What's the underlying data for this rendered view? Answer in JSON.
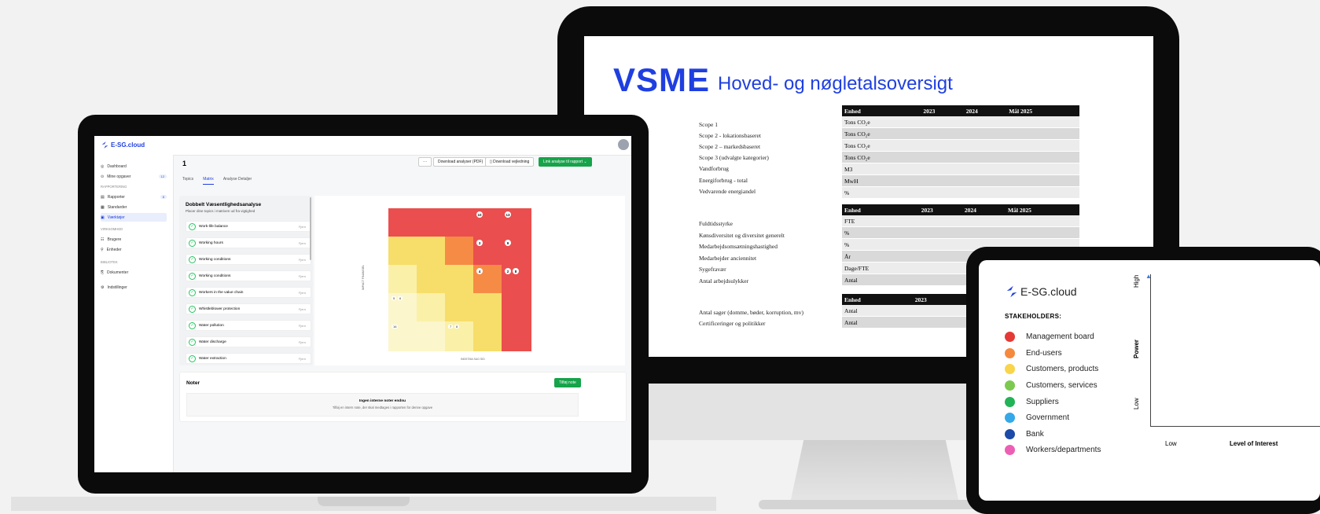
{
  "monitor": {
    "title_big": "VSME",
    "title_sub": "Hoved- og nøgletalsoversigt",
    "table_headers": [
      "Enhed",
      "2023",
      "2024",
      "Mål 2025"
    ],
    "table1": {
      "labels": [
        "Scope 1",
        "Scope 2 - lokationsbaseret",
        "Scope 2 – markedsbaseret",
        "Scope 3 (udvalgte kategorier)",
        "Vandforbrug",
        "Energiforbrug - total",
        "Vedvarende energiandel"
      ],
      "units": [
        "Tons CO₂e",
        "Tons CO₂e",
        "Tons CO₂e",
        "Tons CO₂e",
        "M3",
        "MwH",
        "%"
      ]
    },
    "table2": {
      "labels": [
        "Fuldtidsstyrke",
        "Kønsdiversitet og diversitet generelt",
        "Medarbejdsomsætningshastighed",
        "Medarbejder anciennitet",
        "Sygefravær",
        "Antal arbejdsulykker"
      ],
      "units": [
        "FTE",
        "%",
        "%",
        "År",
        "Dage/FTE",
        "Antal"
      ]
    },
    "table3": {
      "labels": [
        "Antal sager (domme, bøder, korruption, mv)",
        "Certificeringer og politikker"
      ],
      "units": [
        "Antal",
        "Antal"
      ]
    }
  },
  "laptop": {
    "brand": "E-SG.cloud",
    "sidebar": {
      "dashboard": "Dashboard",
      "tasks": "Mine opgaver",
      "tasks_badge": "12",
      "section_reporting": "RAPPORTERING",
      "reports": "Rapporter",
      "reports_badge": "8",
      "standards": "Standarder",
      "templates": "Værktøjer",
      "section_company": "VIRKSOMHED",
      "users": "Brugere",
      "entities": "Enheder",
      "section_library": "BIBLIOTEK",
      "documents": "Dokumenter",
      "settings": "Indstillinger"
    },
    "page_number": "1",
    "buttons": {
      "more": "···",
      "download_pdf": "Download analyser (PDF)",
      "download_guide": "Download vejledning",
      "link_report": "Link analyse til rapport"
    },
    "tabs": [
      "Topics",
      "Matrix",
      "Analyse Detaljer"
    ],
    "panel_title": "Dobbelt Væsentlighedsanalyse",
    "panel_subtitle": "Placer dine topics i matrixen ud fra vigtighed",
    "remove_label": "Fjern",
    "topics": [
      "Work-life balance",
      "Working hours",
      "Working conditions",
      "Working conditions",
      "Workers in the value chain",
      "Whistleblower protection",
      "Water pollution",
      "Water discharge",
      "Water extraction"
    ],
    "matrix_y_label": "IMPACT FINANSIEL",
    "matrix_x_label": "INDSTMA SAG SID",
    "matrix_dots": [
      "10",
      "13",
      "3",
      "9",
      "4",
      "2",
      "8"
    ],
    "matrix_chips": [
      "5",
      "6",
      "16",
      "7",
      "8"
    ],
    "notes_title": "Noter",
    "add_note": "Tilføj note",
    "notes_empty_title": "Ingen interne noter endnu",
    "notes_empty_text": "Tilføj en intern note, der skal medtages i rapporten for denne opgave"
  },
  "tablet": {
    "brand": "E-SG.cloud",
    "stakeholders_title": "STAKEHOLDERS:",
    "stakeholders": [
      {
        "name": "Management board",
        "color": "#e53935"
      },
      {
        "name": "End-users",
        "color": "#f5893d"
      },
      {
        "name": "Customers, products",
        "color": "#f8d54a"
      },
      {
        "name": "Customers, services",
        "color": "#7cc94f"
      },
      {
        "name": "Suppliers",
        "color": "#22b357"
      },
      {
        "name": "Government",
        "color": "#35a8e8"
      },
      {
        "name": "Bank",
        "color": "#1b4aa8"
      },
      {
        "name": "Workers/departments",
        "color": "#ec5fb5"
      }
    ],
    "y_axis": {
      "high": "High",
      "title": "Power",
      "low": "Low"
    },
    "x_axis": {
      "low": "Low",
      "title": "Level of Interest"
    }
  },
  "colors": {
    "brand_blue": "#1f3fe0",
    "accent_green": "#16a34a"
  }
}
